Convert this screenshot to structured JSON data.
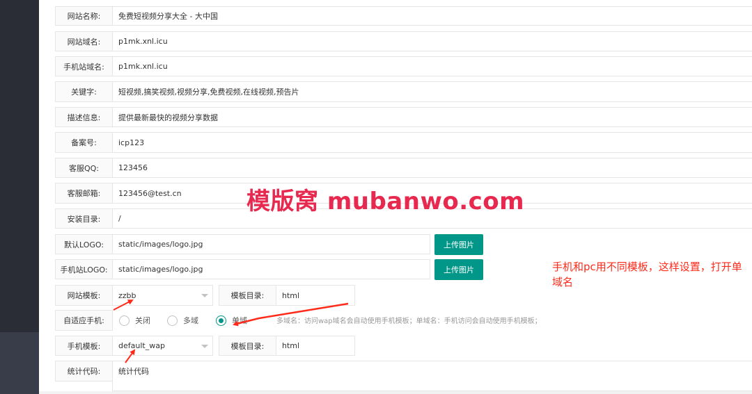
{
  "form": {
    "site_name": {
      "label": "网站名称:",
      "value": "免费短视频分享大全 - 大中国"
    },
    "site_domain": {
      "label": "网站域名:",
      "value": "p1mk.xnl.icu"
    },
    "mobile_domain": {
      "label": "手机站域名:",
      "value": "p1mk.xnl.icu"
    },
    "keywords": {
      "label": "关键字:",
      "value": "短视频,搞笑视频,视频分享,免费视频,在线视频,预告片"
    },
    "description": {
      "label": "描述信息:",
      "value": "提供最新最快的视频分享数据"
    },
    "icp": {
      "label": "备案号:",
      "value": "icp123"
    },
    "service_qq": {
      "label": "客服QQ:",
      "value": "123456"
    },
    "service_email": {
      "label": "客服邮箱:",
      "value": "123456@test.cn"
    },
    "install_dir": {
      "label": "安装目录:",
      "value": "/"
    },
    "default_logo": {
      "label": "默认LOGO:",
      "value": "static/images/logo.jpg",
      "button": "上传图片"
    },
    "mobile_logo": {
      "label": "手机站LOGO:",
      "value": "static/images/logo.jpg",
      "button": "上传图片"
    },
    "site_template": {
      "label": "网站模板:",
      "value": "zzbb",
      "dir_label": "模板目录:",
      "dir_value": "html"
    },
    "adaptive_mobile": {
      "label": "自适应手机:",
      "options": [
        {
          "label": "关闭",
          "selected": false
        },
        {
          "label": "多域",
          "selected": false
        },
        {
          "label": "单域",
          "selected": true
        }
      ],
      "hint": "多域名：访问wap域名会自动使用手机模板；单域名：手机访问会自动使用手机模板；"
    },
    "mobile_template": {
      "label": "手机模板:",
      "value": "default_wap",
      "dir_label": "模板目录:",
      "dir_value": "html"
    },
    "stats_code": {
      "label": "统计代码:",
      "value": "统计代码"
    }
  },
  "overlay": {
    "watermark": "模版窝 mubanwo.com",
    "note": "手机和pc用不同模板，这样设置，打开单域名",
    "accent_color": "#ff2a1a",
    "watermark_color": "#e8294f"
  },
  "theme": {
    "button_color": "#009688",
    "sidebar_color": "#2a2d36"
  }
}
